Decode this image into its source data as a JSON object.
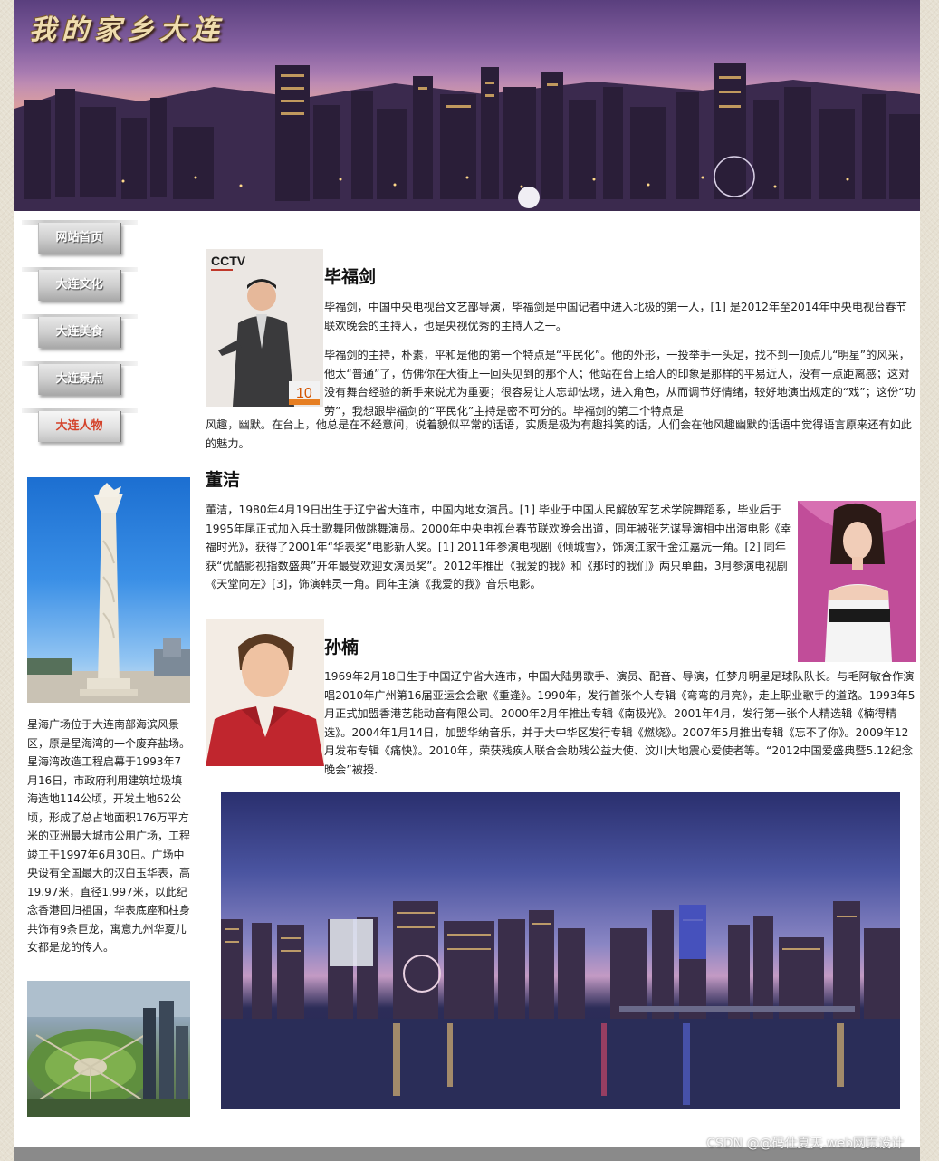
{
  "banner": {
    "title": "我的家乡大连"
  },
  "nav": {
    "items": [
      {
        "label": "网站首页",
        "active": false
      },
      {
        "label": "大连文化",
        "active": false
      },
      {
        "label": "大连美食",
        "active": false
      },
      {
        "label": "大连景点",
        "active": false
      },
      {
        "label": "大连人物",
        "active": true
      }
    ],
    "active_color": "#d4422a"
  },
  "left": {
    "monument_caption": "星海广场位于大连南部海滨风景区，原是星海湾的一个废弃盐场。星海湾改造工程启幕于1993年7月16日，市政府利用建筑垃圾填海造地114公顷，开发土地62公顷，形成了总占地面积176万平方米的亚洲最大城市公用广场，工程竣工于1997年6月30日。广场中央设有全国最大的汉白玉华表，高19.97米，直径1.997米，以此纪念香港回归祖国，华表底座和柱身共饰有9条巨龙，寓意九州华夏儿女都是龙的传人。"
  },
  "people": [
    {
      "name": "毕福剑",
      "photo_logo": "CCTV",
      "paragraph1": "毕福剑，中国中央电视台文艺部导演，毕福剑是中国记者中进入北极的第一人，[1] 是2012年至2014年中央电视台春节联欢晚会的主持人，也是央视优秀的主持人之一。",
      "paragraph2": "毕福剑的主持，朴素，平和是他的第一个特点是“平民化”。他的外形，一投举手一头足，找不到一顶点儿“明星”的风采，他太“普通”了，仿佛你在大街上一回头见到的那个人；他站在台上给人的印象是那样的平易近人，没有一点距离感；这对没有舞台经验的新手来说尤为重要；很容易让人忘却怯场，进入角色，从而调节好情绪，较好地演出规定的“戏”；这份“功劳”，我想跟毕福剑的“平民化”主持是密不可分的。毕福剑的第二个特点是",
      "paragraph2_cont": "风趣，幽默。在台上，他总是在不经意间，说着貌似平常的话语，实质是极为有趣抖笑的话，人们会在他风趣幽默的话语中觉得语言原来还有如此的魅力。"
    },
    {
      "name": "董洁",
      "paragraph1": "董洁，1980年4月19日出生于辽宁省大连市，中国内地女演员。[1] 毕业于中国人民解放军艺术学院舞蹈系，毕业后于1995年尾正式加入兵士歌舞团做跳舞演员。2000年中央电视台春节联欢晚会出道，同年被张艺谋导演相中出演电影《幸福时光》，获得了2001年“华表奖”电影新人奖。[1] 2011年参演电视剧《倾城雪》，饰演江家千金江嘉沅一角。[2] 同年获“优酷影视指数盛典”开年最受欢迎女演员奖”。2012年推出《我爱的我》和《那时的我们》两只单曲，3月参演电视剧《天堂向左》[3]，饰演韩灵一角。同年主演《我爱的我》音乐电影。"
    },
    {
      "name": "孙楠",
      "paragraph1": "1969年2月18日生于中国辽宁省大连市，中国大陆男歌手、演员、配音、导演，任梦舟明星足球队队长。与毛阿敏合作演唱2010年广州第16届亚运会会歌《重逢》。1990年，发行首张个人专辑《弯弯的月亮》，走上职业歌手的道路。1993年5月正式加盟香港艺能动音有限公司。2000年2月年推出专辑《南极光》。2001年4月，发行第一张个人精选辑《楠得精选》。2004年1月14日，加盟华纳音乐，并于大中华区发行专辑《燃烧》。2007年5月推出专辑《忘不了你》。2009年12月发布专辑《痛快》。2010年，荣获残疾人联合会助残公益大使、汶川大地震心爱使者等。“2012中国爱盛典暨5.12纪念晚会”被授."
    }
  ],
  "footer": {
    "watermark": "CSDN @@码仕夏天.web网页设计"
  }
}
